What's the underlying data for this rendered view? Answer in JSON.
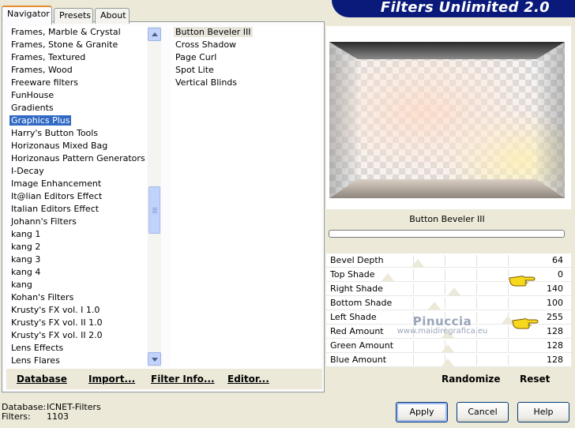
{
  "banner": {
    "title": "Filters Unlimited 2.0"
  },
  "tabs": [
    {
      "label": "Navigator",
      "active": true
    },
    {
      "label": "Presets",
      "active": false
    },
    {
      "label": "About",
      "active": false
    }
  ],
  "categories": [
    "Frames, Marble & Crystal",
    "Frames, Stone & Granite",
    "Frames, Textured",
    "Frames, Wood",
    "Freeware filters",
    "FunHouse",
    "Gradients",
    "Graphics Plus",
    "Harry's Button Tools",
    "Horizonaus Mixed Bag",
    "Horizonaus Pattern Generators",
    "I-Decay",
    "Image Enhancement",
    "It@lian Editors Effect",
    "Italian Editors Effect",
    "Johann's Filters",
    "kang 1",
    "kang 2",
    "kang 3",
    "kang 4",
    "kang",
    "Kohan's Filters",
    "Krusty's FX vol. I 1.0",
    "Krusty's FX vol. II 1.0",
    "Krusty's FX vol. II 2.0",
    "Lens Effects",
    "Lens Flares"
  ],
  "selected_category": "Graphics Plus",
  "filters": [
    "Button Beveler III",
    "Cross Shadow",
    "Page Curl",
    "Spot Lite",
    "Vertical Blinds"
  ],
  "selected_filter": "Button Beveler III",
  "left_buttons": {
    "database": "Database",
    "import": "Import...",
    "filter_info": "Filter Info...",
    "editor": "Editor..."
  },
  "preview": {
    "filter_name": "Button Beveler III"
  },
  "params": [
    {
      "label": "Bevel Depth",
      "value": "64",
      "level": 0.25
    },
    {
      "label": "Top Shade",
      "value": "0",
      "level": 0.0
    },
    {
      "label": "Right Shade",
      "value": "140",
      "level": 0.55
    },
    {
      "label": "Bottom Shade",
      "value": "100",
      "level": 0.39
    },
    {
      "label": "Left Shade",
      "value": "255",
      "level": 1.0
    },
    {
      "label": "Red Amount",
      "value": "128",
      "level": 0.5
    },
    {
      "label": "Green Amount",
      "value": "128",
      "level": 0.5
    },
    {
      "label": "Blue Amount",
      "value": "128",
      "level": 0.5
    }
  ],
  "watermark": {
    "name": "Pinuccia",
    "site": "www.maidiregrafica.eu"
  },
  "right_buttons": {
    "randomize": "Randomize",
    "reset": "Reset"
  },
  "status": {
    "database_label": "Database:",
    "database_value": "ICNET-Filters",
    "filters_label": "Filters:",
    "filters_value": "1103"
  },
  "dialog": {
    "apply": "Apply",
    "cancel": "Cancel",
    "help": "Help"
  },
  "colors": {
    "banner": "#0a1a7a",
    "selection": "#316ac5",
    "tab_highlight": "#e68b2c"
  },
  "icons": {
    "scroll_up": "chevron-up-icon",
    "scroll_down": "chevron-down-icon",
    "pointer": "pointing-hand-icon"
  }
}
